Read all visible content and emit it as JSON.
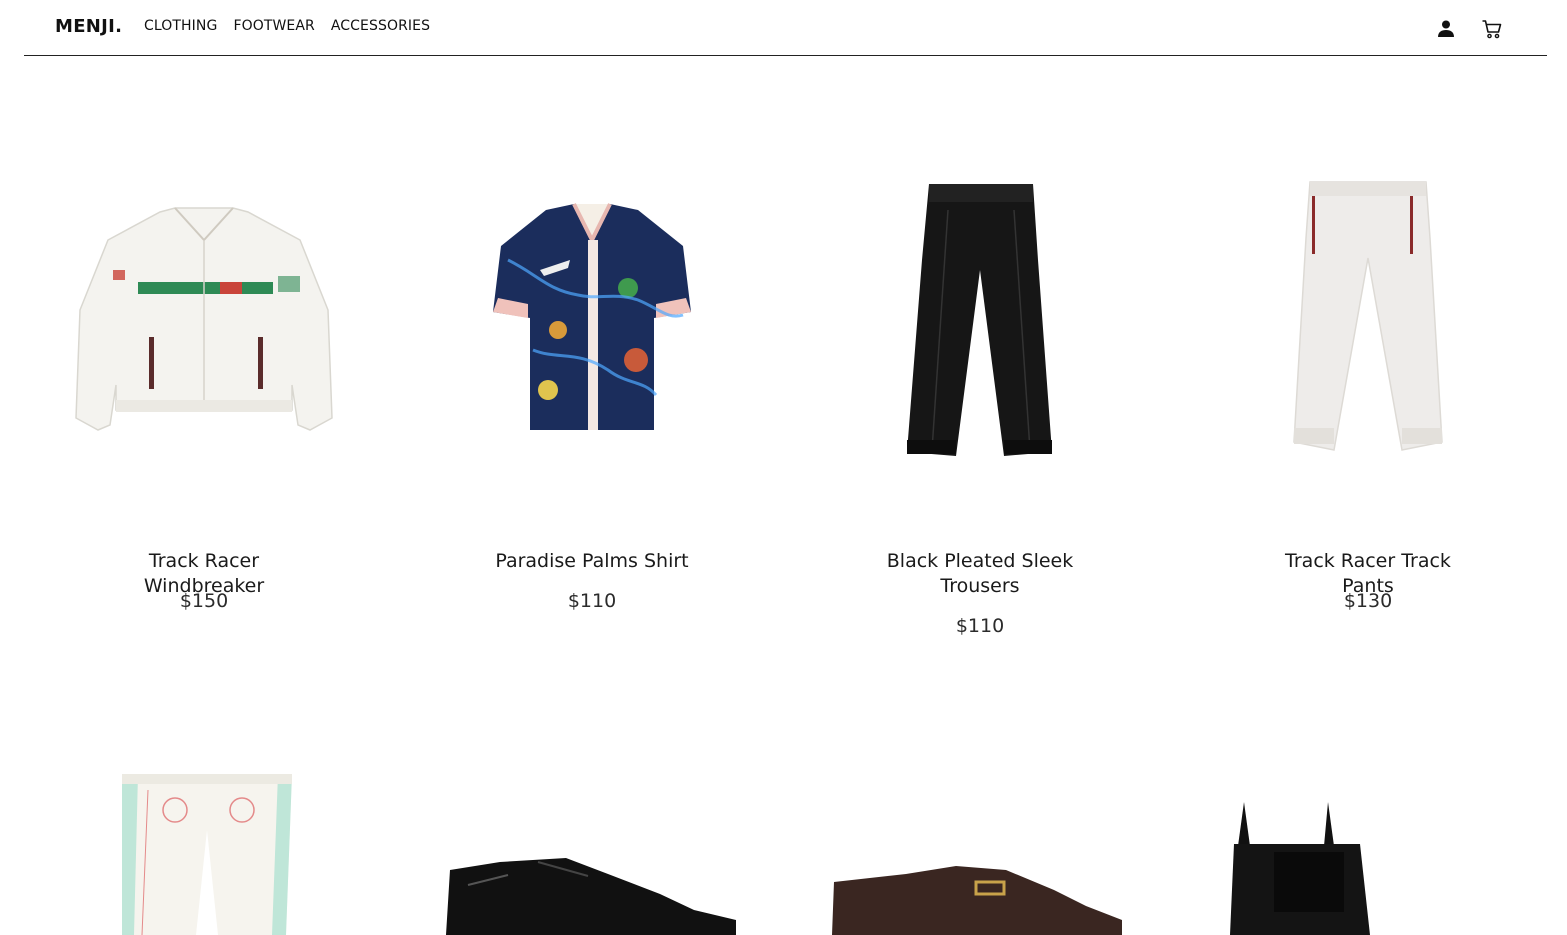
{
  "header": {
    "logo": "MENJI.",
    "nav": [
      "CLOTHING",
      "FOOTWEAR",
      "ACCESSORIES"
    ],
    "icons": [
      "user-icon",
      "cart-icon"
    ]
  },
  "products": [
    {
      "title": "Track Racer Windbreaker",
      "price": "$150"
    },
    {
      "title": "Paradise Palms Shirt",
      "price": "$110"
    },
    {
      "title": "Black Pleated Sleek Trousers",
      "price": "$110"
    },
    {
      "title": "Track Racer Track Pants",
      "price": "$130"
    }
  ],
  "colors": {
    "text": "#1a1a1a",
    "border": "#222222"
  }
}
